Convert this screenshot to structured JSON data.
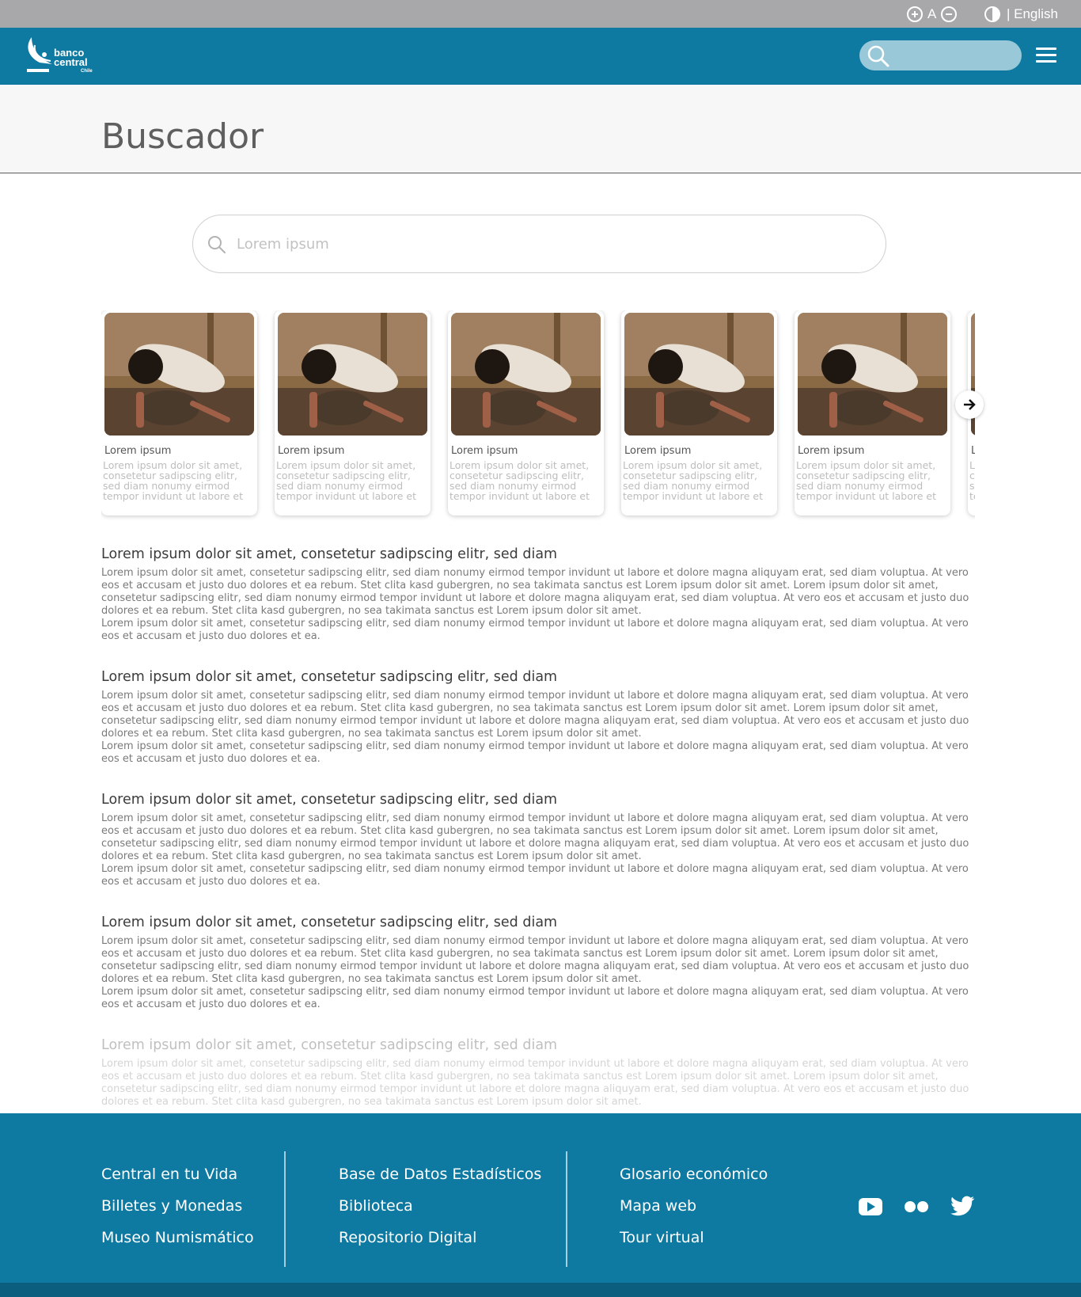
{
  "utility_bar": {
    "font_size_label": "A",
    "language_label": "| English"
  },
  "header": {
    "logo_line1": "banco",
    "logo_line2": "central",
    "logo_sub": "Chile",
    "search_placeholder": ""
  },
  "page": {
    "title": "Buscador"
  },
  "search": {
    "placeholder": "Lorem ipsum"
  },
  "carousel": {
    "cards": [
      {
        "title": "Lorem ipsum",
        "description": "Lorem ipsum dolor sit amet, consetetur sadipscing elitr, sed diam nonumy eirmod tempor invidunt ut labore et"
      },
      {
        "title": "Lorem ipsum",
        "description": "Lorem ipsum dolor sit amet, consetetur sadipscing elitr, sed diam nonumy eirmod tempor invidunt ut labore et"
      },
      {
        "title": "Lorem ipsum",
        "description": "Lorem ipsum dolor sit amet, consetetur sadipscing elitr, sed diam nonumy eirmod tempor invidunt ut labore et"
      },
      {
        "title": "Lorem ipsum",
        "description": "Lorem ipsum dolor sit amet, consetetur sadipscing elitr, sed diam nonumy eirmod tempor invidunt ut labore et"
      },
      {
        "title": "Lorem ipsum",
        "description": "Lorem ipsum dolor sit amet, consetetur sadipscing elitr, sed diam nonumy eirmod tempor invidunt ut labore et"
      },
      {
        "title": "Lorem ipsum",
        "description": "Lorem ipsum dolor sit amet, consetetur sadipscing elitr, sed diam nonumy eirmod tempor invidunt ut labore et"
      }
    ]
  },
  "results": [
    {
      "title": "Lorem ipsum dolor sit amet, consetetur sadipscing elitr, sed diam",
      "paragraph1": "Lorem ipsum dolor sit amet, consetetur sadipscing elitr, sed diam nonumy eirmod tempor invidunt ut labore et dolore magna aliquyam erat, sed diam voluptua. At vero eos et accusam et justo duo dolores et ea rebum. Stet clita kasd gubergren, no sea takimata sanctus est Lorem ipsum dolor sit amet. Lorem ipsum dolor sit amet, consetetur sadipscing elitr, sed diam nonumy eirmod tempor invidunt ut labore et dolore magna aliquyam erat, sed diam voluptua. At vero eos et accusam et justo duo dolores et ea rebum. Stet clita kasd gubergren, no sea takimata sanctus est Lorem ipsum dolor sit amet.",
      "paragraph2": "Lorem ipsum dolor sit amet, consetetur sadipscing elitr, sed diam nonumy eirmod tempor invidunt ut labore et dolore magna aliquyam erat, sed diam voluptua. At vero eos et accusam et justo duo dolores et ea."
    },
    {
      "title": "Lorem ipsum dolor sit amet, consetetur sadipscing elitr, sed diam",
      "paragraph1": "Lorem ipsum dolor sit amet, consetetur sadipscing elitr, sed diam nonumy eirmod tempor invidunt ut labore et dolore magna aliquyam erat, sed diam voluptua. At vero eos et accusam et justo duo dolores et ea rebum. Stet clita kasd gubergren, no sea takimata sanctus est Lorem ipsum dolor sit amet. Lorem ipsum dolor sit amet, consetetur sadipscing elitr, sed diam nonumy eirmod tempor invidunt ut labore et dolore magna aliquyam erat, sed diam voluptua. At vero eos et accusam et justo duo dolores et ea rebum. Stet clita kasd gubergren, no sea takimata sanctus est Lorem ipsum dolor sit amet.",
      "paragraph2": "Lorem ipsum dolor sit amet, consetetur sadipscing elitr, sed diam nonumy eirmod tempor invidunt ut labore et dolore magna aliquyam erat, sed diam voluptua. At vero eos et accusam et justo duo dolores et ea."
    },
    {
      "title": "Lorem ipsum dolor sit amet, consetetur sadipscing elitr, sed diam",
      "paragraph1": "Lorem ipsum dolor sit amet, consetetur sadipscing elitr, sed diam nonumy eirmod tempor invidunt ut labore et dolore magna aliquyam erat, sed diam voluptua. At vero eos et accusam et justo duo dolores et ea rebum. Stet clita kasd gubergren, no sea takimata sanctus est Lorem ipsum dolor sit amet. Lorem ipsum dolor sit amet, consetetur sadipscing elitr, sed diam nonumy eirmod tempor invidunt ut labore et dolore magna aliquyam erat, sed diam voluptua. At vero eos et accusam et justo duo dolores et ea rebum. Stet clita kasd gubergren, no sea takimata sanctus est Lorem ipsum dolor sit amet.",
      "paragraph2": "Lorem ipsum dolor sit amet, consetetur sadipscing elitr, sed diam nonumy eirmod tempor invidunt ut labore et dolore magna aliquyam erat, sed diam voluptua. At vero eos et accusam et justo duo dolores et ea."
    },
    {
      "title": "Lorem ipsum dolor sit amet, consetetur sadipscing elitr, sed diam",
      "paragraph1": "Lorem ipsum dolor sit amet, consetetur sadipscing elitr, sed diam nonumy eirmod tempor invidunt ut labore et dolore magna aliquyam erat, sed diam voluptua. At vero eos et accusam et justo duo dolores et ea rebum. Stet clita kasd gubergren, no sea takimata sanctus est Lorem ipsum dolor sit amet. Lorem ipsum dolor sit amet, consetetur sadipscing elitr, sed diam nonumy eirmod tempor invidunt ut labore et dolore magna aliquyam erat, sed diam voluptua. At vero eos et accusam et justo duo dolores et ea rebum. Stet clita kasd gubergren, no sea takimata sanctus est Lorem ipsum dolor sit amet.",
      "paragraph2": "Lorem ipsum dolor sit amet, consetetur sadipscing elitr, sed diam nonumy eirmod tempor invidunt ut labore et dolore magna aliquyam erat, sed diam voluptua. At vero eos et accusam et justo duo dolores et ea."
    },
    {
      "title": "Lorem ipsum dolor sit amet, consetetur sadipscing elitr, sed diam",
      "paragraph1": "Lorem ipsum dolor sit amet, consetetur sadipscing elitr, sed diam nonumy eirmod tempor invidunt ut labore et dolore magna aliquyam erat, sed diam voluptua. At vero eos et accusam et justo duo dolores et ea rebum. Stet clita kasd gubergren, no sea takimata sanctus est Lorem ipsum dolor sit amet. Lorem ipsum dolor sit amet, consetetur sadipscing elitr, sed diam nonumy eirmod tempor invidunt ut labore et dolore magna aliquyam erat, sed diam voluptua. At vero eos et accusam et justo duo dolores et ea rebum. Stet clita kasd gubergren, no sea takimata sanctus est Lorem ipsum dolor sit amet.",
      "paragraph2": ""
    }
  ],
  "footer": {
    "col1": [
      "Central en tu Vida",
      "Billetes y Monedas",
      "Museo Numismático"
    ],
    "col2": [
      "Base de Datos Estadísticos",
      "Biblioteca",
      "Repositorio Digital"
    ],
    "col3": [
      "Glosario económico",
      "Mapa web",
      "Tour virtual"
    ]
  },
  "colors": {
    "brand": "#0f7aa1",
    "utility_bar": "#a8a8aa",
    "footer_bottom": "#0b5e7e"
  },
  "icons": [
    "plus-circle-icon",
    "minus-circle-icon",
    "contrast-icon",
    "search-icon",
    "menu-icon",
    "arrow-right-icon",
    "youtube-icon",
    "flickr-icon",
    "twitter-icon"
  ]
}
